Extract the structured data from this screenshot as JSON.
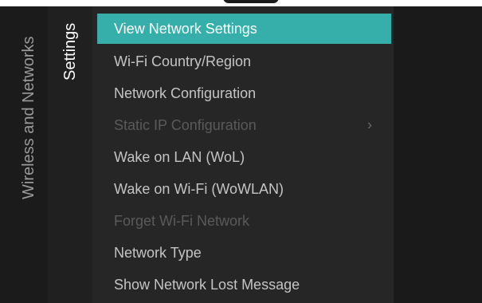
{
  "breadcrumb": {
    "label": "Wireless and Networks"
  },
  "category": {
    "label": "Settings"
  },
  "menu": {
    "items": [
      {
        "label": "View Network Settings",
        "state": "selected"
      },
      {
        "label": "Wi-Fi Country/Region",
        "state": "normal"
      },
      {
        "label": "Network Configuration",
        "state": "normal"
      },
      {
        "label": "Static IP Configuration",
        "state": "disabled",
        "submenu": true,
        "chevron": "›"
      },
      {
        "label": "Wake on LAN (WoL)",
        "state": "normal"
      },
      {
        "label": "Wake on Wi-Fi (WoWLAN)",
        "state": "normal"
      },
      {
        "label": "Forget Wi-Fi Network",
        "state": "disabled"
      },
      {
        "label": "Network Type",
        "state": "normal"
      },
      {
        "label": "Show Network Lost Message",
        "state": "normal"
      }
    ]
  },
  "colors": {
    "selection": "#36afaa",
    "text": "#c4c4c4",
    "text_disabled": "#5a5a5a",
    "background": "#1a1a1a"
  },
  "icons": {
    "submenu": "chevron-right-icon"
  }
}
